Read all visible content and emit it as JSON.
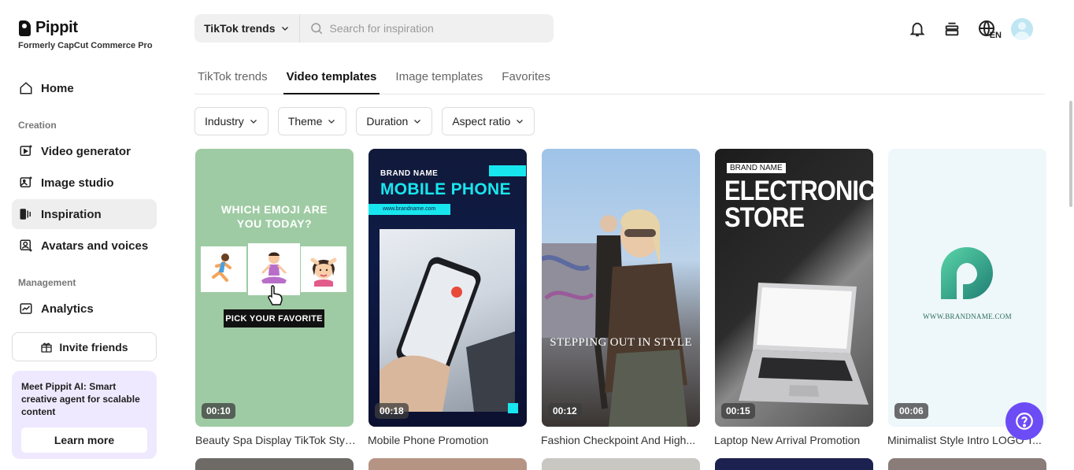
{
  "brand": {
    "name": "Pippit",
    "subtitle": "Formerly CapCut Commerce Pro"
  },
  "sidebar": {
    "home": "Home",
    "section_creation": "Creation",
    "items_creation": [
      "Video generator",
      "Image studio",
      "Inspiration",
      "Avatars and voices"
    ],
    "section_management": "Management",
    "analytics": "Analytics",
    "invite": "Invite friends",
    "promo_text": "Meet Pippit AI: Smart creative agent for scalable content",
    "learn_more": "Learn more"
  },
  "search": {
    "category": "TikTok trends",
    "placeholder": "Search for inspiration"
  },
  "header": {
    "lang": "EN"
  },
  "tabs": [
    "TikTok trends",
    "Video templates",
    "Image templates",
    "Favorites"
  ],
  "active_tab": "Video templates",
  "filters": [
    "Industry",
    "Theme",
    "Duration",
    "Aspect ratio"
  ],
  "cards": [
    {
      "title": "Beauty Spa Display TikTok Style...",
      "duration": "00:10",
      "headline": "WHICH EMOJI ARE YOU TODAY?",
      "cta": "PICK YOUR FAVORITE"
    },
    {
      "title": "Mobile Phone Promotion",
      "duration": "00:18",
      "brand": "BRAND NAME",
      "headline": "MOBILE PHONE",
      "url": "www.brandname.com"
    },
    {
      "title": "Fashion Checkpoint And High...",
      "duration": "00:12",
      "caption": "STEPPING OUT IN STYLE"
    },
    {
      "title": "Laptop New Arrival Promotion",
      "duration": "00:15",
      "brand": "BRAND NAME",
      "headline_1": "ELECTRONIC",
      "headline_2": "STORE"
    },
    {
      "title": "Minimalist Style Intro LOGO T...",
      "duration": "00:06",
      "url": "WWW.BRANDNAME.COM"
    }
  ],
  "colors": {
    "accent": "#6c4cf5",
    "active_nav": "#eeeeee",
    "promo_bg": "#efe9ff",
    "cyan": "#18e6ee"
  }
}
